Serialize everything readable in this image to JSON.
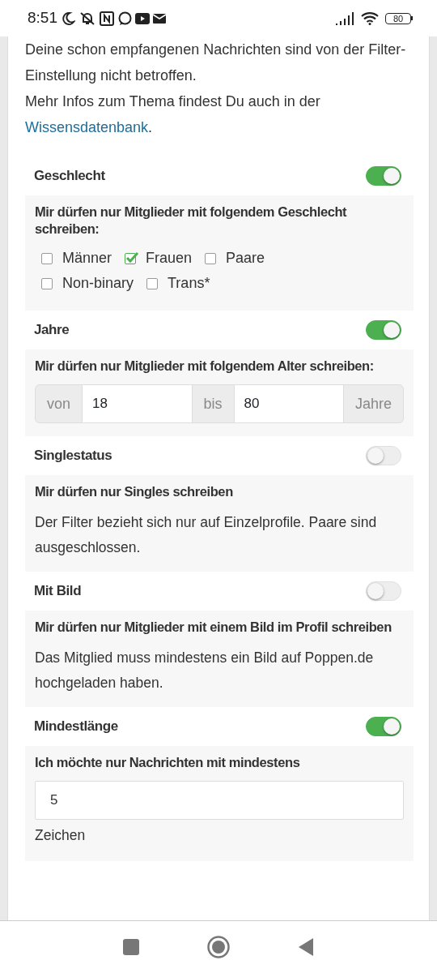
{
  "status_bar": {
    "time": "8:51",
    "battery": "80"
  },
  "intro": [
    {
      "text": "Deine schon empfangenen Nachrichten sind von der Filter-Einstellung nicht betroffen."
    },
    {
      "text": "Mehr Infos zum Thema findest Du auch in der ",
      "link": "Wissensdatenbank",
      "after": "."
    }
  ],
  "sections": [
    {
      "title": "Geschlecht",
      "on": true,
      "kind": "checkboxes",
      "heading": "Mir dürfen nur Mitglieder mit folgendem Geschlecht schreiben:",
      "options": [
        {
          "label": "Männer",
          "checked": false
        },
        {
          "label": "Frauen",
          "checked": true
        },
        {
          "label": "Paare",
          "checked": false
        },
        {
          "label": "Non-binary",
          "checked": false
        },
        {
          "label": "Trans*",
          "checked": false
        }
      ]
    },
    {
      "title": "Jahre",
      "on": true,
      "kind": "range",
      "heading": "Mir dürfen nur Mitglieder mit folgendem Alter schreiben:",
      "from_label": "von",
      "from_value": "18",
      "to_label": "bis",
      "to_value": "80",
      "unit": "Jahre"
    },
    {
      "title": "Singlestatus",
      "on": false,
      "kind": "text",
      "heading": "Mir dürfen nur Singles schreiben",
      "text": "Der Filter bezieht sich nur auf Einzelprofile. Paare sind ausgeschlossen."
    },
    {
      "title": "Mit Bild",
      "on": false,
      "kind": "text",
      "heading": "Mir dürfen nur Mitglieder mit einem Bild im Profil schreiben",
      "text": "Das Mitglied muss mindestens ein Bild auf Poppen.de hochgeladen haben."
    },
    {
      "title": "Mindestlänge",
      "on": true,
      "kind": "number",
      "heading": "Ich möchte nur Nachrichten mit mindestens",
      "value": "5",
      "unit": "Zeichen"
    }
  ]
}
